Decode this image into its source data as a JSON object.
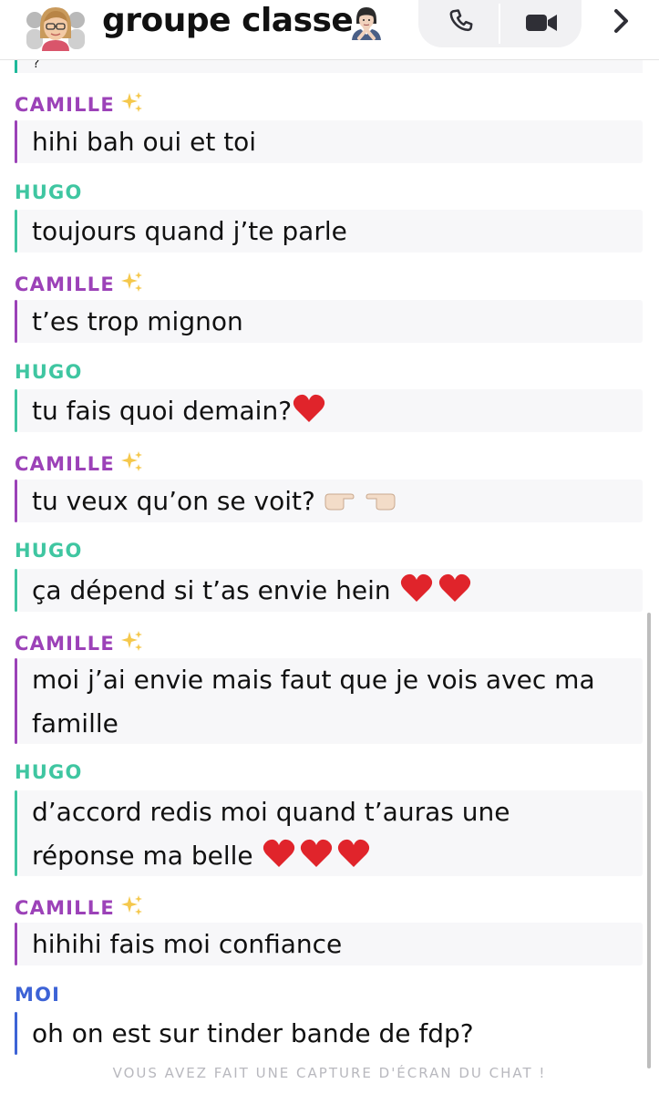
{
  "header": {
    "title": "groupe classe",
    "avatar_icon": "bitmoji-group-avatar",
    "title_emoji": "person-gesturing-no-emoji",
    "call_icon": "phone-icon",
    "video_icon": "video-camera-icon",
    "next_icon": "chevron-right-icon"
  },
  "top_remnant": "?",
  "messages": [
    {
      "sender": "CAMILLE",
      "text": "hihi bah oui et toi"
    },
    {
      "sender": "HUGO",
      "text": "toujours quand j’te parle"
    },
    {
      "sender": "CAMILLE",
      "text": "t’es trop mignon"
    },
    {
      "sender": "HUGO",
      "text": "tu fais quoi demain?"
    },
    {
      "sender": "CAMILLE",
      "text": "tu veux qu’on se voit? "
    },
    {
      "sender": "HUGO",
      "text": "ça dépend si t’as envie hein "
    },
    {
      "sender": "CAMILLE",
      "text": "moi j’ai envie mais faut que je vois avec ma famille"
    },
    {
      "sender": "HUGO",
      "text": "d’accord redis moi quand t’auras une réponse ma belle "
    },
    {
      "sender": "CAMILLE",
      "text": "hihihi fais moi confiance"
    },
    {
      "sender": "MOI",
      "text": "oh on est sur tinder bande de fdp?"
    }
  ],
  "footer_note": "VOUS AVEZ FAIT UNE CAPTURE D'ÉCRAN DU CHAT !",
  "colors": {
    "camille": "#9c42b8",
    "hugo": "#3fc6a1",
    "moi": "#3d63d6",
    "bubble": "#f7f7f9"
  }
}
